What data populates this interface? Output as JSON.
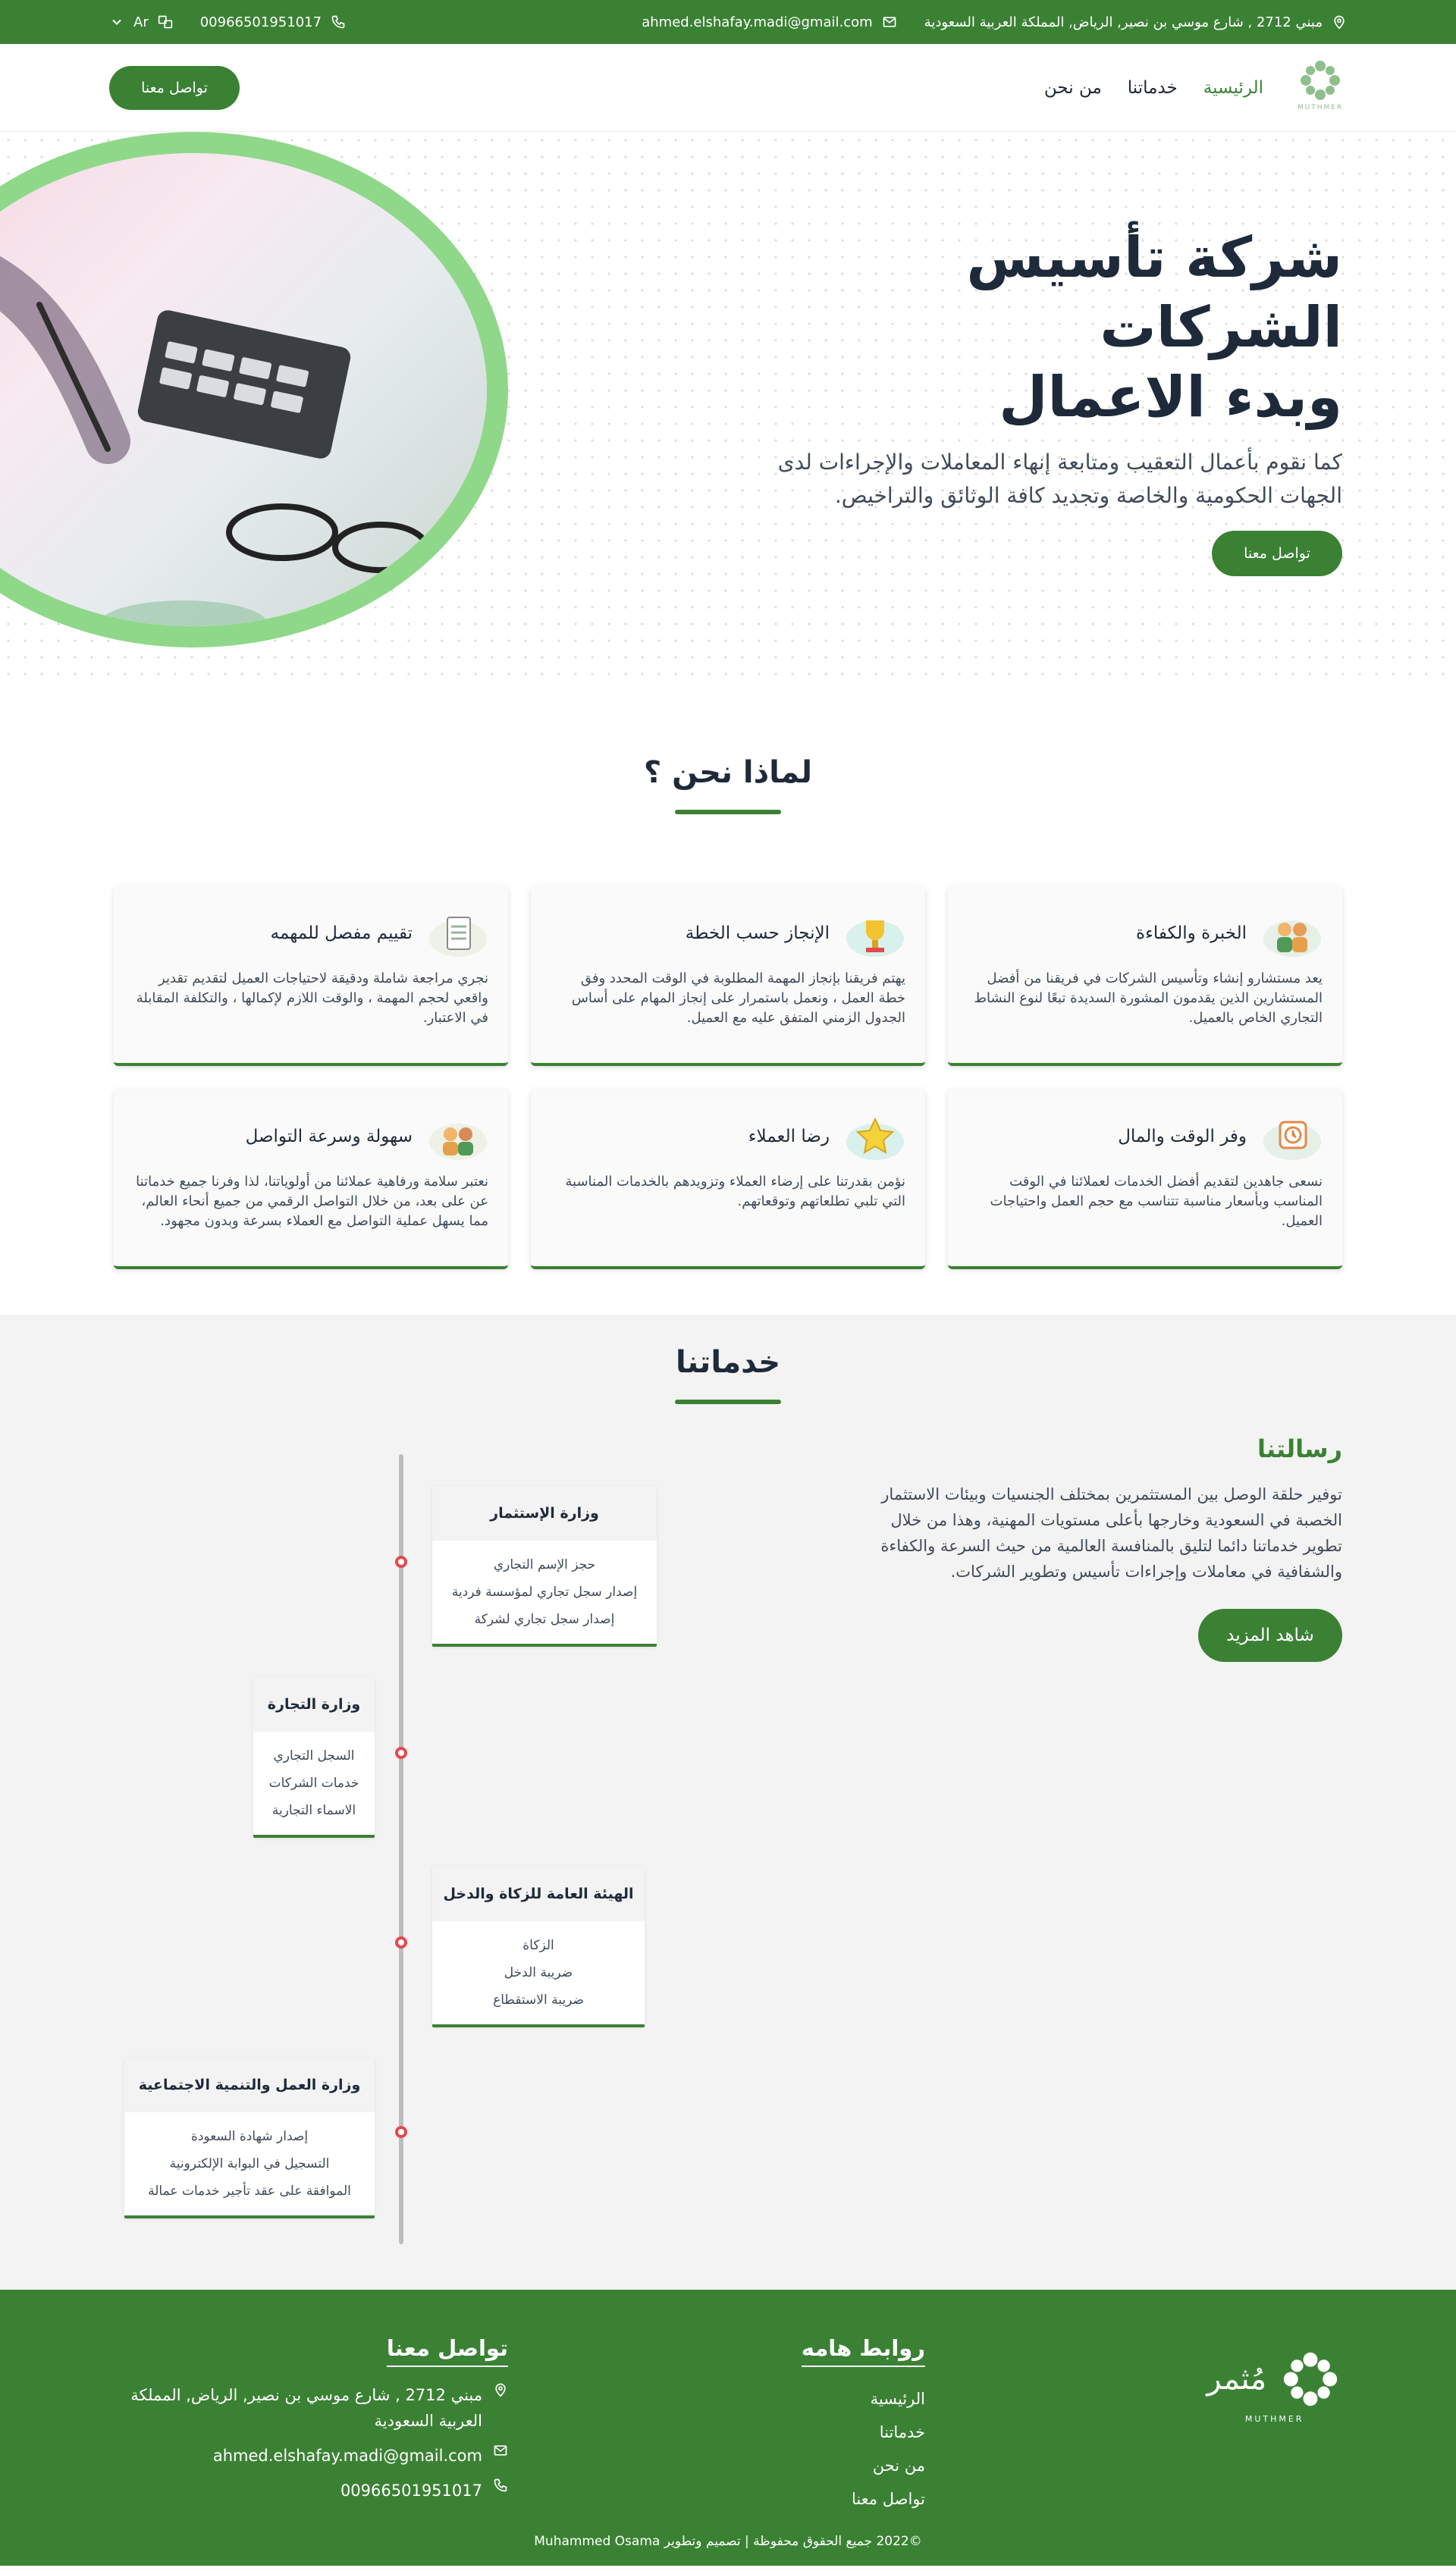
{
  "topbar": {
    "address": "مبني 2712 , شارع موسي بن نصير, الرياض, المملكة العربية السعودية",
    "email": "ahmed.elshafay.madi@gmail.com",
    "phone": "00966501951017",
    "lang": "Ar"
  },
  "nav": {
    "logo_text": "MUTHMER",
    "links": [
      "الرئيسية",
      "خدماتنا",
      "من نحن"
    ],
    "cta": "تواصل معنا"
  },
  "hero": {
    "title_line1": "شركة تأسيس الشركات",
    "title_line2": "وبدء الاعمال",
    "desc": "كما نقوم بأعمال التعقيب ومتابعة إنهاء المعاملات والإجراءات لدى الجهات الحكومية والخاصة وتجديد كافة الوثائق والتراخيص.",
    "cta": "تواصل معنا"
  },
  "why": {
    "title": "لماذا نحن ؟",
    "cards": [
      {
        "icon": "team-icon",
        "title": "الخبرة والكفاءة",
        "text": "يعد مستشارو إنشاء وتأسيس الشركات في فريقنا من أفضل المستشارين الذين يقدمون المشورة السديدة تبعًا لنوع النشاط التجاري الخاص بالعميل."
      },
      {
        "icon": "trophy-icon",
        "title": "الإنجاز حسب الخطة",
        "text": "يهتم فريقنا بإنجاز المهمة المطلوبة في الوقت المحدد وفق خطة العمل ، ونعمل باستمرار على إنجاز المهام على أساس الجدول الزمني المتفق عليه مع العميل."
      },
      {
        "icon": "checklist-icon",
        "title": "تقييم مفصل للمهمه",
        "text": "نجري مراجعة شاملة ودقيقة لاحتياجات العميل لتقديم تقدير واقعي لحجم المهمة ، والوقت اللازم لإكمالها ، والتكلفة المقابلة في الاعتبار."
      },
      {
        "icon": "clock-icon",
        "title": "وفر الوقت والمال",
        "text": "نسعى جاهدين لتقديم أفضل الخدمات لعملائنا في الوقت المناسب وبأسعار مناسبة تتناسب مع حجم العمل واحتياجات العميل."
      },
      {
        "icon": "star-icon",
        "title": "رضا العملاء",
        "text": "نؤمن بقدرتنا على إرضاء العملاء وتزويدهم بالخدمات المناسبة التي تلبي تطلعاتهم وتوقعاتهم."
      },
      {
        "icon": "chat-icon",
        "title": "سهولة وسرعة التواصل",
        "text": "نعتبر سلامة ورفاهية عملائنا من أولوياتنا، لذا وفرنا جميع خدماتنا عن على بعد، من خلال التواصل الرقمي من جميع أنحاء العالم، مما يسهل عملية التواصل مع العملاء بسرعة وبدون مجهود."
      }
    ]
  },
  "services": {
    "title": "خدماتنا",
    "mission_title": "رسالتنا",
    "mission_text": "توفير حلقة الوصل بين المستثمرين بمختلف الجنسيات وبيئات الاستثمار الخصبة في السعودية وخارجها بأعلى مستويات المهنية، وهذا من خلال تطوير خدماتنا دائما لتليق بالمنافسة العالمية من حيث السرعة والكفاءة والشفافية في معاملات وإجراءات تأسيس وتطوير الشركات.",
    "more": "شاهد المزيد",
    "timeline": [
      {
        "title": "وزارة الإستثمار",
        "items": [
          "حجز الإسم التجاري",
          "إصدار سجل تجاري لمؤسسة فردية",
          "إصدار سجل تجاري لشركة"
        ]
      },
      {
        "title": "وزارة التجارة",
        "items": [
          "السجل التجاري",
          "خدمات الشركات",
          "الاسماء التجارية"
        ]
      },
      {
        "title": "الهيئة العامة للزكاة والدخل",
        "items": [
          "الزكاة",
          "ضريبة الدخل",
          "ضريبة الاستقطاع"
        ]
      },
      {
        "title": "وزارة العمل والتنمية الاجتماعية",
        "items": [
          "إصدار شهادة السعودة",
          "التسجيل في البوابة الإلكترونية",
          "الموافقة على عقد تأجير خدمات عمالة"
        ]
      }
    ]
  },
  "footer": {
    "logo_ar": "مُثمر",
    "logo_en": "MUTHMER",
    "links_title": "روابط هامه",
    "links": [
      "الرئيسية",
      "خدماتنا",
      "من نحن",
      "تواصل معنا"
    ],
    "contact_title": "تواصل معنا",
    "address": "مبني 2712 , شارع موسي بن نصير, الرياض, المملكة العربية السعودية",
    "email": "ahmed.elshafay.madi@gmail.com",
    "phone": "00966501951017",
    "copyright": "©2022 جميع الحقوق محفوظة | تصميم وتطوير Muhammed Osama"
  },
  "colors": {
    "brand": "#3b8134",
    "accent_light": "#8fd88a",
    "timeline_dot": "#e5484d"
  }
}
